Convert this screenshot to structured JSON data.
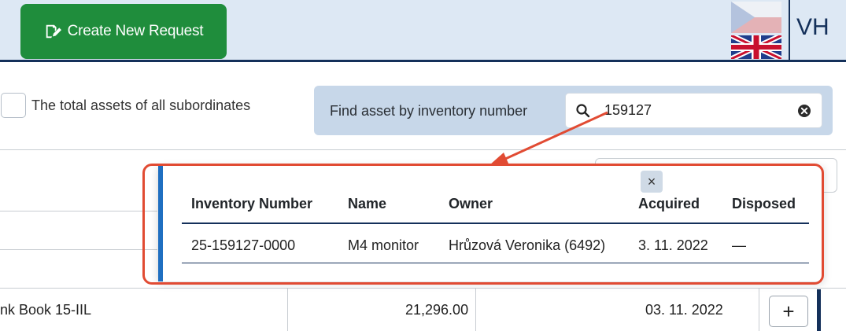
{
  "header": {
    "create_button_label": "Create New Request",
    "user_initials": "VH",
    "colors": {
      "header_bg": "#dde8f4",
      "accent_green": "#1f8d3c",
      "navy": "#14305a"
    }
  },
  "toolbar": {
    "subordinates_label": "The total assets of all subordinates",
    "find_label": "Find asset by inventory number",
    "search_value": "159127"
  },
  "popup": {
    "columns": [
      "Inventory Number",
      "Name",
      "Owner",
      "Acquired",
      "Disposed"
    ],
    "rows": [
      [
        "25-159127-0000",
        "M4 monitor",
        "Hrůzová Veronika (6492)",
        "3. 11. 2022",
        "—"
      ]
    ],
    "close_label": "×"
  },
  "background_row": {
    "name": "nk Book 15-IIL",
    "price": "21,296.00",
    "date": "03. 11. 2022",
    "add_label": "+"
  },
  "annotation": {
    "color": "#e14b33"
  }
}
